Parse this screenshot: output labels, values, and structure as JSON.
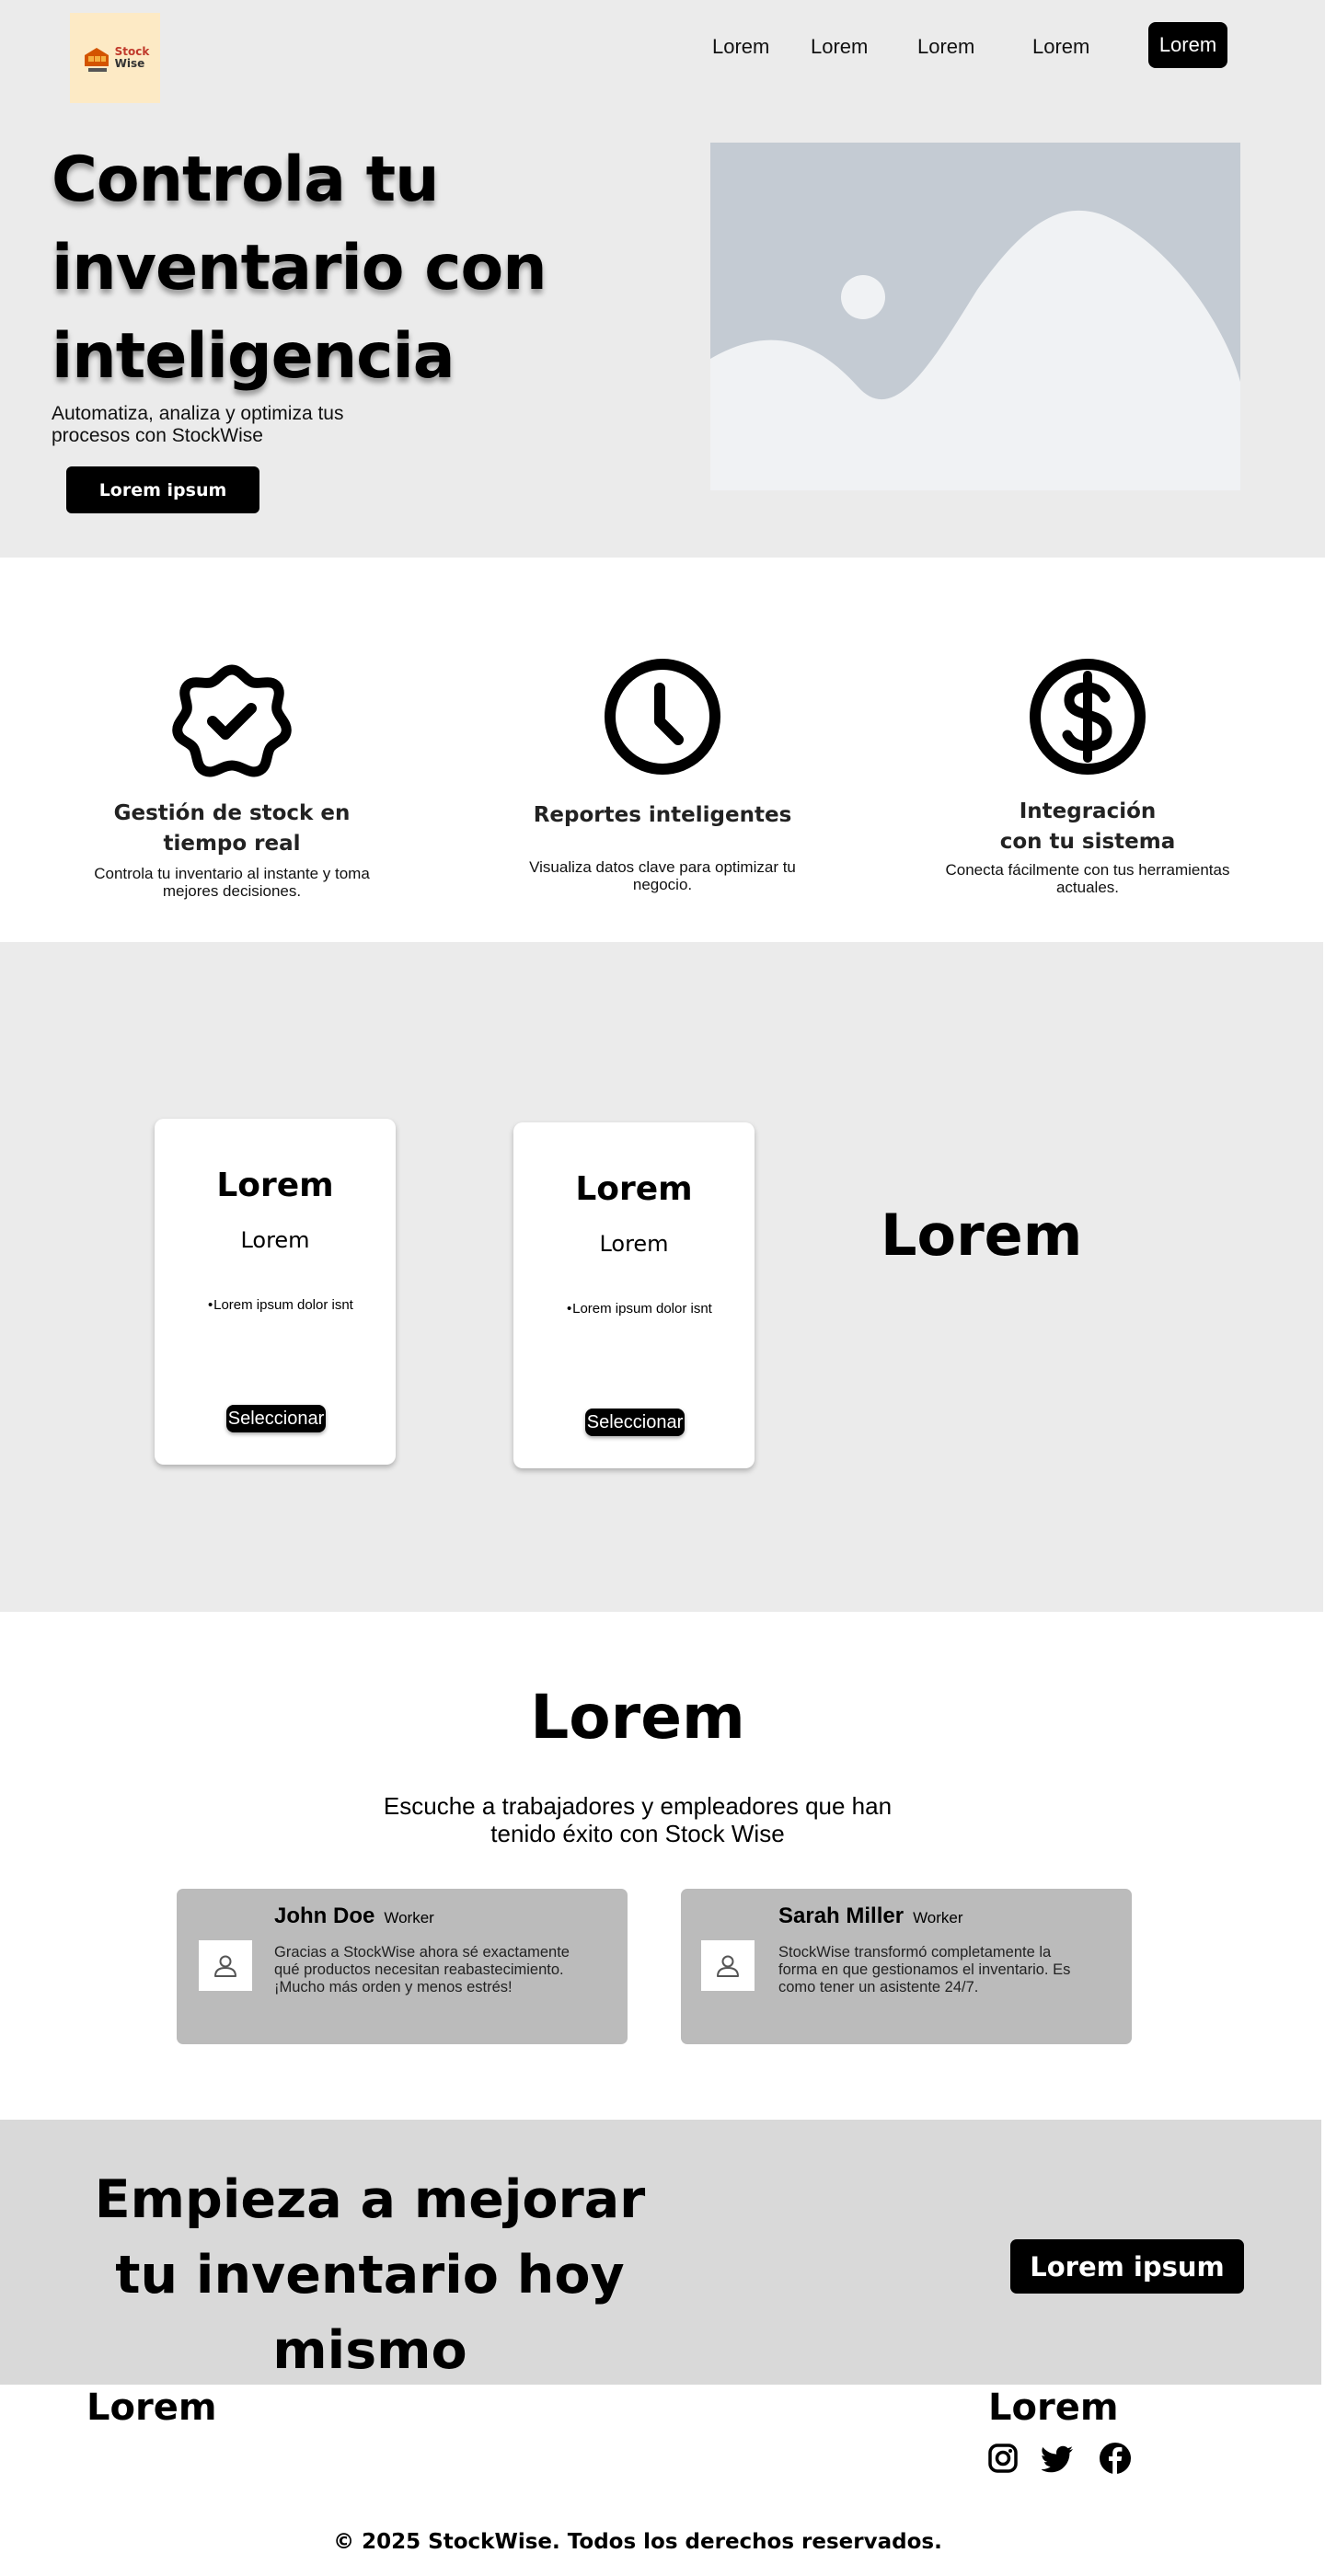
{
  "header": {
    "logo": {
      "line1": "Stock",
      "line2": "Wise",
      "icon": "warehouse-icon"
    },
    "nav": [
      "Lorem",
      "Lorem",
      "Lorem",
      "Lorem"
    ],
    "nav_button": "Lorem"
  },
  "hero": {
    "title": "Controla tu inventario con inteligencia",
    "subtitle": "Automatiza, analiza y optimiza tus procesos con StockWise",
    "button": "Lorem ipsum",
    "image": "image-placeholder"
  },
  "features": [
    {
      "icon": "badge-check-icon",
      "title": "Gestión de stock en tiempo real",
      "desc": "Controla tu inventario al instante y toma mejores decisiones."
    },
    {
      "icon": "clock-icon",
      "title": "Reportes inteligentes",
      "desc": "Visualiza datos clave para optimizar tu negocio."
    },
    {
      "icon": "dollar-circle-icon",
      "title": "Integración con tu sistema",
      "desc": "Conecta fácilmente con tus herramientas actuales."
    }
  ],
  "pricing": {
    "plans": [
      {
        "title": "Lorem",
        "price": "Lorem",
        "feature": "Lorem ipsum dolor isnt",
        "button": "Seleccionar"
      },
      {
        "title": "Lorem",
        "price": "Lorem",
        "feature": "Lorem ipsum dolor isnt",
        "button": "Seleccionar"
      }
    ],
    "side_heading": "Lorem"
  },
  "testimonials": {
    "title": "Lorem",
    "subtitle": "Escuche a trabajadores y empleadores que han tenido éxito con Stock Wise",
    "items": [
      {
        "name": "John Doe",
        "role": "Worker",
        "text": "Gracias a StockWise ahora sé exactamente qué productos necesitan reabastecimiento. ¡Mucho más orden y menos estrés!"
      },
      {
        "name": "Sarah Miller",
        "role": "Worker",
        "text": "StockWise transformó completamente la forma en que gestionamos el inventario. Es como tener un asistente 24/7."
      }
    ]
  },
  "cta": {
    "title": "Empieza a mejorar tu inventario hoy mismo",
    "button": "Lorem ipsum"
  },
  "footer": {
    "left_heading": "Lorem",
    "right_heading": "Lorem",
    "social": [
      "instagram-icon",
      "twitter-icon",
      "facebook-icon"
    ],
    "copyright": "© 2025 StockWise. Todos los derechos reservados."
  },
  "colors": {
    "hero_bg": "#ebebeb",
    "logo_bg": "#fdeac5",
    "button_bg": "#000000",
    "testimonial_card_bg": "#bbbbbb",
    "cta_bg": "#d9d9d9",
    "image_placeholder_bg": "#c4cbd3"
  }
}
